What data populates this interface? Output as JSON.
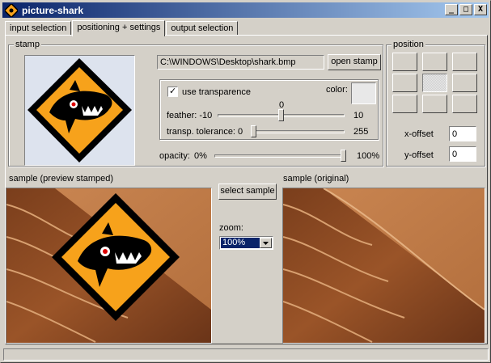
{
  "window": {
    "title": "picture-shark"
  },
  "titlebar_buttons": {
    "minimize": "_",
    "maximize": "□",
    "close": "X"
  },
  "tabs": [
    {
      "label": "input selection",
      "active": false
    },
    {
      "label": "positioning + settings",
      "active": true
    },
    {
      "label": "output selection",
      "active": false
    }
  ],
  "stamp": {
    "group_title": "stamp",
    "path": "C:\\WINDOWS\\Desktop\\shark.bmp",
    "open_button": "open stamp",
    "use_transparence_label": "use transparence",
    "use_transparence_checked": true,
    "color_label": "color:",
    "color_value": "#e8e8e8",
    "feather": {
      "label": "feather: -10",
      "min_label": "-10",
      "max_label": "10",
      "current_label": "0",
      "value": 0,
      "min": -10,
      "max": 10
    },
    "tolerance": {
      "label": "transp. tolerance: 0",
      "max_label": "255",
      "value": 0,
      "min": 0,
      "max": 255
    },
    "opacity": {
      "label": "opacity:",
      "min_label": "0%",
      "max_label": "100%",
      "value": 100
    }
  },
  "position": {
    "group_title": "position",
    "selected_cell": "center",
    "x_offset_label": "x-offset",
    "x_offset_value": "0",
    "y_offset_label": "y-offset",
    "y_offset_value": "0"
  },
  "samples": {
    "preview_label": "sample (preview stamped)",
    "original_label": "sample (original)",
    "select_button": "select sample",
    "zoom_label": "zoom:",
    "zoom_value": "100%"
  },
  "colors": {
    "titlebar_start": "#0a246a",
    "titlebar_end": "#a6caf0",
    "stamp_orange": "#f7a21b",
    "sand": "#b06a36"
  }
}
